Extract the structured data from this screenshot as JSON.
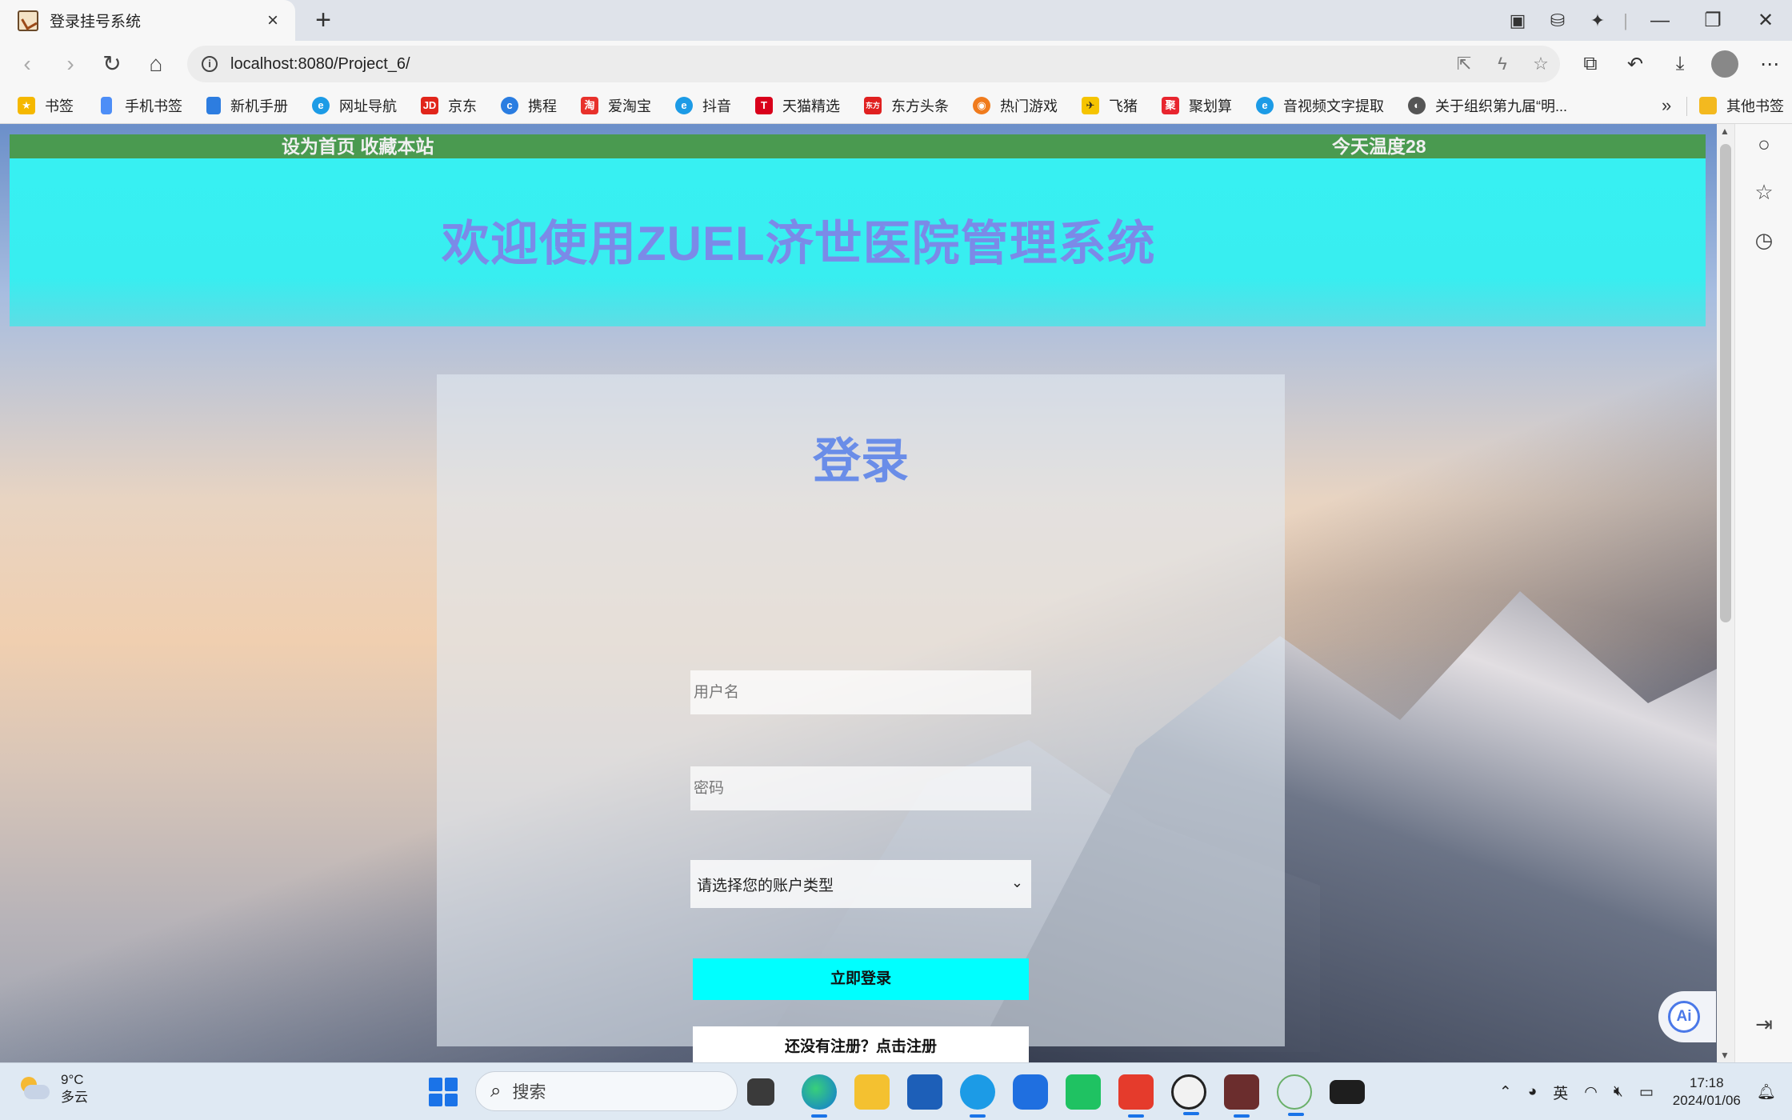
{
  "browser": {
    "tab_title": "登录挂号系统",
    "tab_close": "×",
    "new_tab": "+",
    "url": "localhost:8080/Project_6/",
    "bookmarks": [
      {
        "label": "书签",
        "icon": "star-icon",
        "color": "#f5b800"
      },
      {
        "label": "手机书签",
        "icon": "phone-icon",
        "color": "#4d8ef7"
      },
      {
        "label": "新机手册",
        "icon": "book-icon",
        "color": "#2d7de0"
      },
      {
        "label": "网址导航",
        "icon": "edge-icon",
        "color": "#1c9be6"
      },
      {
        "label": "京东",
        "icon": "jd-icon",
        "color": "#e1251b"
      },
      {
        "label": "携程",
        "icon": "ctrip-icon",
        "color": "#2a7de1"
      },
      {
        "label": "爱淘宝",
        "icon": "taobao-icon",
        "color": "#e8312b"
      },
      {
        "label": "抖音",
        "icon": "edge-icon",
        "color": "#1c9be6"
      },
      {
        "label": "天猫精选",
        "icon": "tmall-icon",
        "color": "#d9001b"
      },
      {
        "label": "东方头条",
        "icon": "toutiao-icon",
        "color": "#e02020"
      },
      {
        "label": "热门游戏",
        "icon": "game-icon",
        "color": "#f07b1d"
      },
      {
        "label": "飞猪",
        "icon": "fliggy-icon",
        "color": "#f5c400"
      },
      {
        "label": "聚划算",
        "icon": "juhuasuan-icon",
        "color": "#e8252f"
      },
      {
        "label": "音视频文字提取",
        "icon": "edge-icon",
        "color": "#1c9be6"
      },
      {
        "label": "关于组织第九届“明...",
        "icon": "globe-icon",
        "color": "#555555"
      }
    ],
    "bookmarks_more": "»",
    "other_bookmarks": "其他书签"
  },
  "page": {
    "top_left_links": "设为首页 收藏本站",
    "top_right_text": "今天温度28",
    "banner_title": "欢迎使用ZUEL济世医院管理系统",
    "login": {
      "title": "登录",
      "username_placeholder": "用户名",
      "password_placeholder": "密码",
      "account_type_selected": "请选择您的账户类型",
      "login_button": "立即登录",
      "register_button": "还没有注册？点击注册"
    },
    "ai_label": "Ai"
  },
  "taskbar": {
    "weather_temp": "9°C",
    "weather_desc": "多云",
    "search_label": "搜索",
    "input_method": "英",
    "time": "17:18",
    "date": "2024/01/06"
  },
  "colors": {
    "banner": "#38eef0",
    "banner_title": "#7b8ae8",
    "login_title": "#6a8de8",
    "login_button": "#00ffff",
    "top_strip": "#4a9a50"
  }
}
